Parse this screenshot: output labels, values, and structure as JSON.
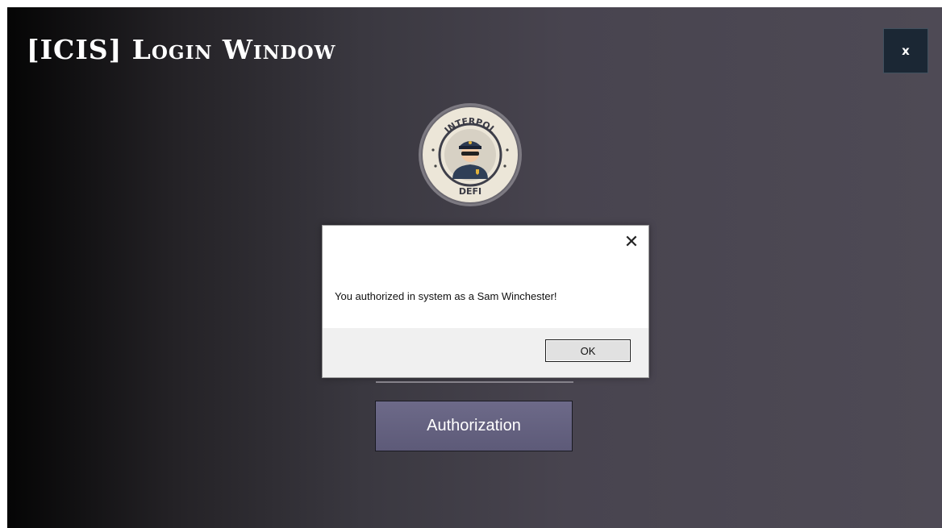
{
  "window": {
    "title": "[ICIS] Login Window",
    "close_label": "x"
  },
  "logo": {
    "top_text": "INTERPOL",
    "bottom_text": "DEFI",
    "icon": "police-officer-icon"
  },
  "form": {
    "submit_label": "Authorization"
  },
  "message_box": {
    "text": "You authorized in system as a Sam Winchester!",
    "ok_label": "OK",
    "close_icon": "close-icon"
  },
  "colors": {
    "button_bg": "#625f7e",
    "close_bg": "#1b2734"
  }
}
